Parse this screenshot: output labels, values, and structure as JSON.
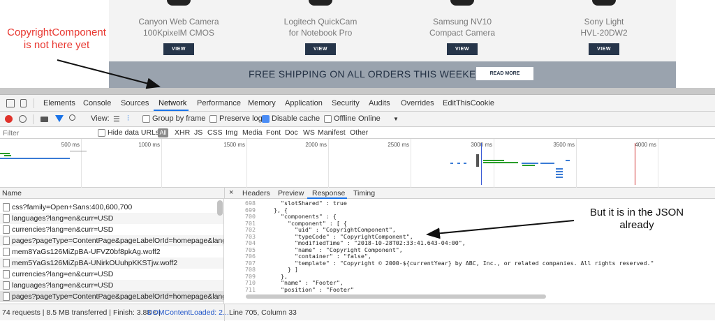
{
  "site": {
    "products": [
      {
        "line1": "Canyon Web Camera",
        "line2": "100KpixelM CMOS",
        "button": "VIEW"
      },
      {
        "line1": "Logitech QuickCam",
        "line2": "for Notebook Pro",
        "button": "VIEW"
      },
      {
        "line1": "Samsung NV10",
        "line2": "Compact Camera",
        "button": "VIEW"
      },
      {
        "line1": "Sony Light",
        "line2": "HVL-20DW2",
        "button": "VIEW"
      }
    ],
    "banner_text": "FREE SHIPPING ON ALL ORDERS THIS WEEKEND",
    "banner_button": "READ MORE"
  },
  "annotations": {
    "left_line1": "CopyrightComponent",
    "left_line2": "is not here yet",
    "right_line1": "But it is in the JSON",
    "right_line2": "already"
  },
  "devtools": {
    "tabs": [
      "Elements",
      "Console",
      "Sources",
      "Network",
      "Performance",
      "Memory",
      "Application",
      "Security",
      "Audits",
      "Overrides",
      "EditThisCookie"
    ],
    "active_tab": "Network",
    "toolbar": {
      "view_label": "View:",
      "group_by_frame": "Group by frame",
      "preserve_log": "Preserve log",
      "disable_cache": "Disable cache",
      "offline": "Offline",
      "throttle": "Online"
    },
    "filter": {
      "placeholder": "Filter",
      "hide_data_urls": "Hide data URLs",
      "types": [
        "All",
        "XHR",
        "JS",
        "CSS",
        "Img",
        "Media",
        "Font",
        "Doc",
        "WS",
        "Manifest",
        "Other"
      ]
    },
    "timeline_ticks": [
      "500 ms",
      "1000 ms",
      "1500 ms",
      "2000 ms",
      "2500 ms",
      "3000 ms",
      "3500 ms",
      "4000 ms"
    ],
    "name_header": "Name",
    "close_glyph": "×",
    "detail_tabs": [
      "Headers",
      "Preview",
      "Response",
      "Timing"
    ],
    "active_detail_tab": "Response",
    "requests": [
      "css?family=Open+Sans:400,600,700",
      "languages?lang=en&curr=USD",
      "currencies?lang=en&curr=USD",
      "pages?pageType=ContentPage&pageLabelOrId=homepage&lang=e...",
      "mem8YaGs126MiZpBA-UFVZ0bf8pkAg.woff2",
      "mem5YaGs126MiZpBA-UNirkOUuhpKKSTjw.woff2",
      "currencies?lang=en&curr=USD",
      "languages?lang=en&curr=USD",
      "pages?pageType=ContentPage&pageLabelOrId=homepage&lang=e..."
    ],
    "selected_request": 8,
    "response_lines": [
      {
        "n": "698",
        "text": "      \"slotShared\" : true"
      },
      {
        "n": "699",
        "text": "    }, {"
      },
      {
        "n": "700",
        "text": "      \"components\" : {"
      },
      {
        "n": "701",
        "text": "        \"component\" : [ {"
      },
      {
        "n": "702",
        "text": "          \"uid\" : \"CopyrightComponent\","
      },
      {
        "n": "703",
        "text": "          \"typeCode\" : \"CopyrightComponent\","
      },
      {
        "n": "704",
        "text": "          \"modifiedTime\" : \"2018-10-28T02:33:41.643-04:00\","
      },
      {
        "n": "705",
        "text": "          \"name\" : \"Copyright Component\","
      },
      {
        "n": "706",
        "text": "          \"container\" : \"false\","
      },
      {
        "n": "707",
        "text": "          \"template\" : \"Copyright © 2000-${currentYear} by ABC, Inc., or related companies. All rights reserved.\""
      },
      {
        "n": "708",
        "text": "        } ]"
      },
      {
        "n": "709",
        "text": "      },"
      },
      {
        "n": "710",
        "text": "      \"name\" : \"Footer\","
      },
      {
        "n": "711",
        "text": "      \"position\" : \"Footer\""
      }
    ],
    "status": {
      "summary": "74 requests | 8.5 MB transferred | Finish: 3.88 s | ",
      "dom_loaded": "DOMContentLoaded: 2...",
      "cursor": "Line 705, Column 33"
    }
  }
}
